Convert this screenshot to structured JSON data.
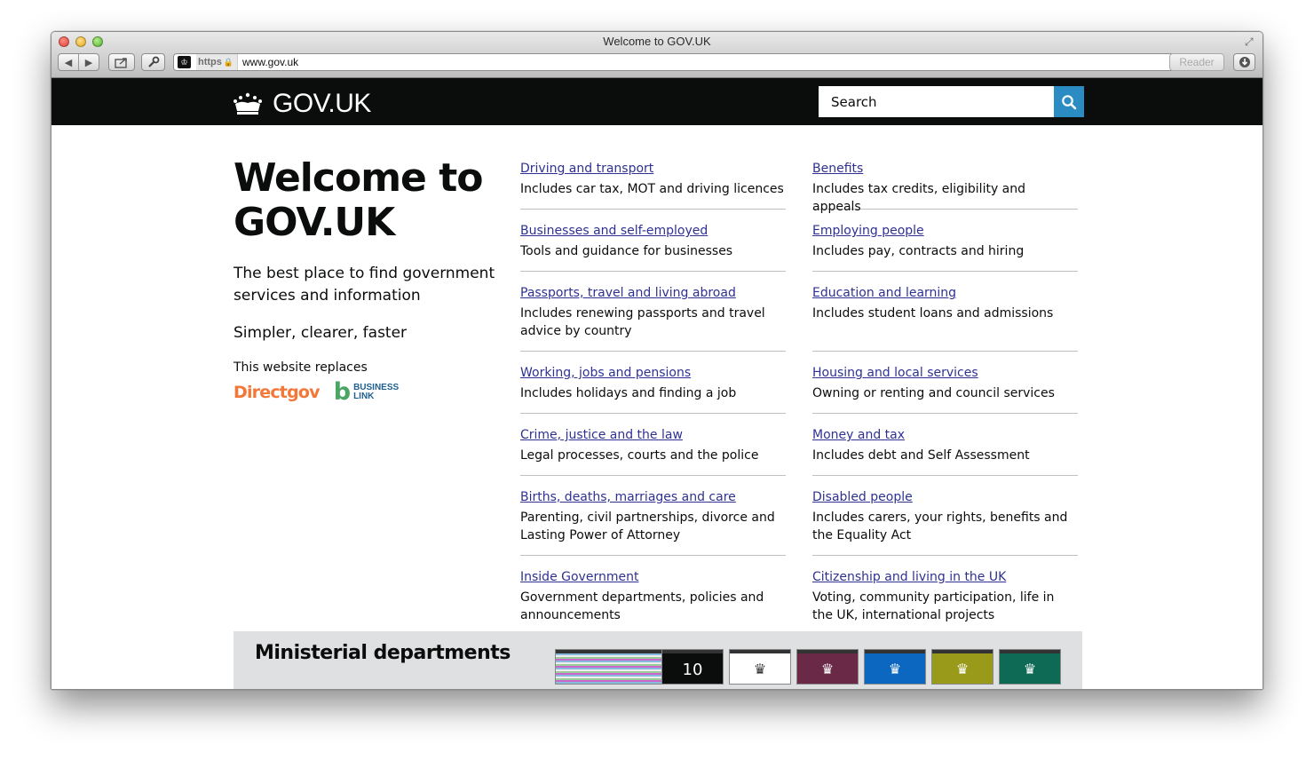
{
  "window": {
    "title": "Welcome to GOV.UK"
  },
  "toolbar": {
    "back_icon": "◀",
    "forward_icon": "▶",
    "share_icon": "share-icon",
    "tools_icon": "wrench-icon",
    "url_protocol": "https",
    "url": "www.gov.uk",
    "reader_label": "Reader"
  },
  "header": {
    "logo_text": "GOV.UK",
    "search_placeholder": "Search",
    "background": "#0b0c0c",
    "search_button_color": "#2b8cc4"
  },
  "intro": {
    "heading": "Welcome to GOV.UK",
    "lead": "The best place to find government services and information",
    "tagline": "Simpler, clearer, faster",
    "replaces_label": "This website replaces",
    "brand_directgov": "Directgov",
    "brand_business_link_1": "BUSINESS",
    "brand_business_link_2": "LINK"
  },
  "categories": {
    "left": [
      {
        "title": "Driving and transport",
        "desc": "Includes car tax, MOT and driving licences"
      },
      {
        "title": "Businesses and self-employed",
        "desc": "Tools and guidance for businesses"
      },
      {
        "title": "Passports, travel and living abroad",
        "desc": "Includes renewing passports and travel advice by country"
      },
      {
        "title": "Working, jobs and pensions",
        "desc": "Includes holidays and finding a job"
      },
      {
        "title": "Crime, justice and the law",
        "desc": "Legal processes, courts and the police"
      },
      {
        "title": "Births, deaths, marriages and care",
        "desc": "Parenting, civil partnerships, divorce and Lasting Power of Attorney"
      },
      {
        "title": "Inside Government",
        "desc": "Government departments, policies and announcements"
      }
    ],
    "right": [
      {
        "title": "Benefits",
        "desc": "Includes tax credits, eligibility and appeals"
      },
      {
        "title": "Employing people",
        "desc": "Includes pay, contracts and hiring"
      },
      {
        "title": "Education and learning",
        "desc": "Includes student loans and admissions"
      },
      {
        "title": "Housing and local services",
        "desc": "Owning or renting and council services"
      },
      {
        "title": "Money and tax",
        "desc": "Includes debt and Self Assessment"
      },
      {
        "title": "Disabled people",
        "desc": "Includes carers, your rights, benefits and the Equality Act"
      },
      {
        "title": "Citizenship and living in the UK",
        "desc": "Voting, community participation, life in the UK, international projects"
      }
    ],
    "link_color": "#2e3191"
  },
  "ministerial": {
    "heading": "Ministerial departments",
    "no10_label": "10"
  }
}
